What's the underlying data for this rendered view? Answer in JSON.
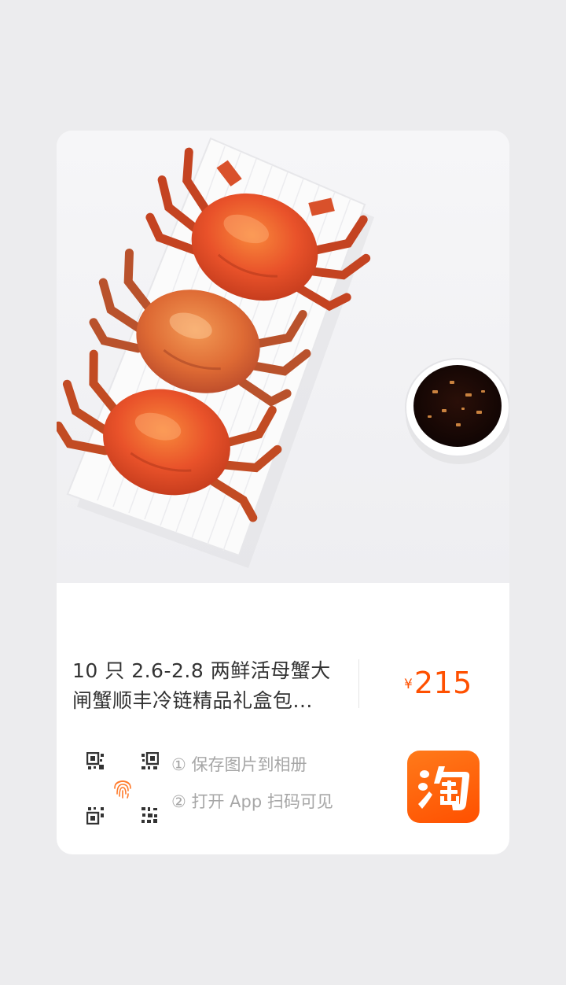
{
  "product": {
    "title_line1": "10 只 2.6-2.8 两鲜活母蟹大",
    "title_line2": "闸蟹顺丰冷链精品礼盒包...",
    "price_symbol": "¥",
    "price": "215"
  },
  "share": {
    "step1": "① 保存图片到相册",
    "step2": "② 打开 App 扫码可见"
  },
  "icons": {
    "qr": "qr-code-icon",
    "fingerprint": "fingerprint-icon",
    "app_logo": "taobao-app-icon"
  },
  "colors": {
    "accent": "#ff5000",
    "background": "#ececee",
    "card": "#ffffff",
    "hint_text": "#a6a6a6",
    "title_text": "#333333"
  }
}
